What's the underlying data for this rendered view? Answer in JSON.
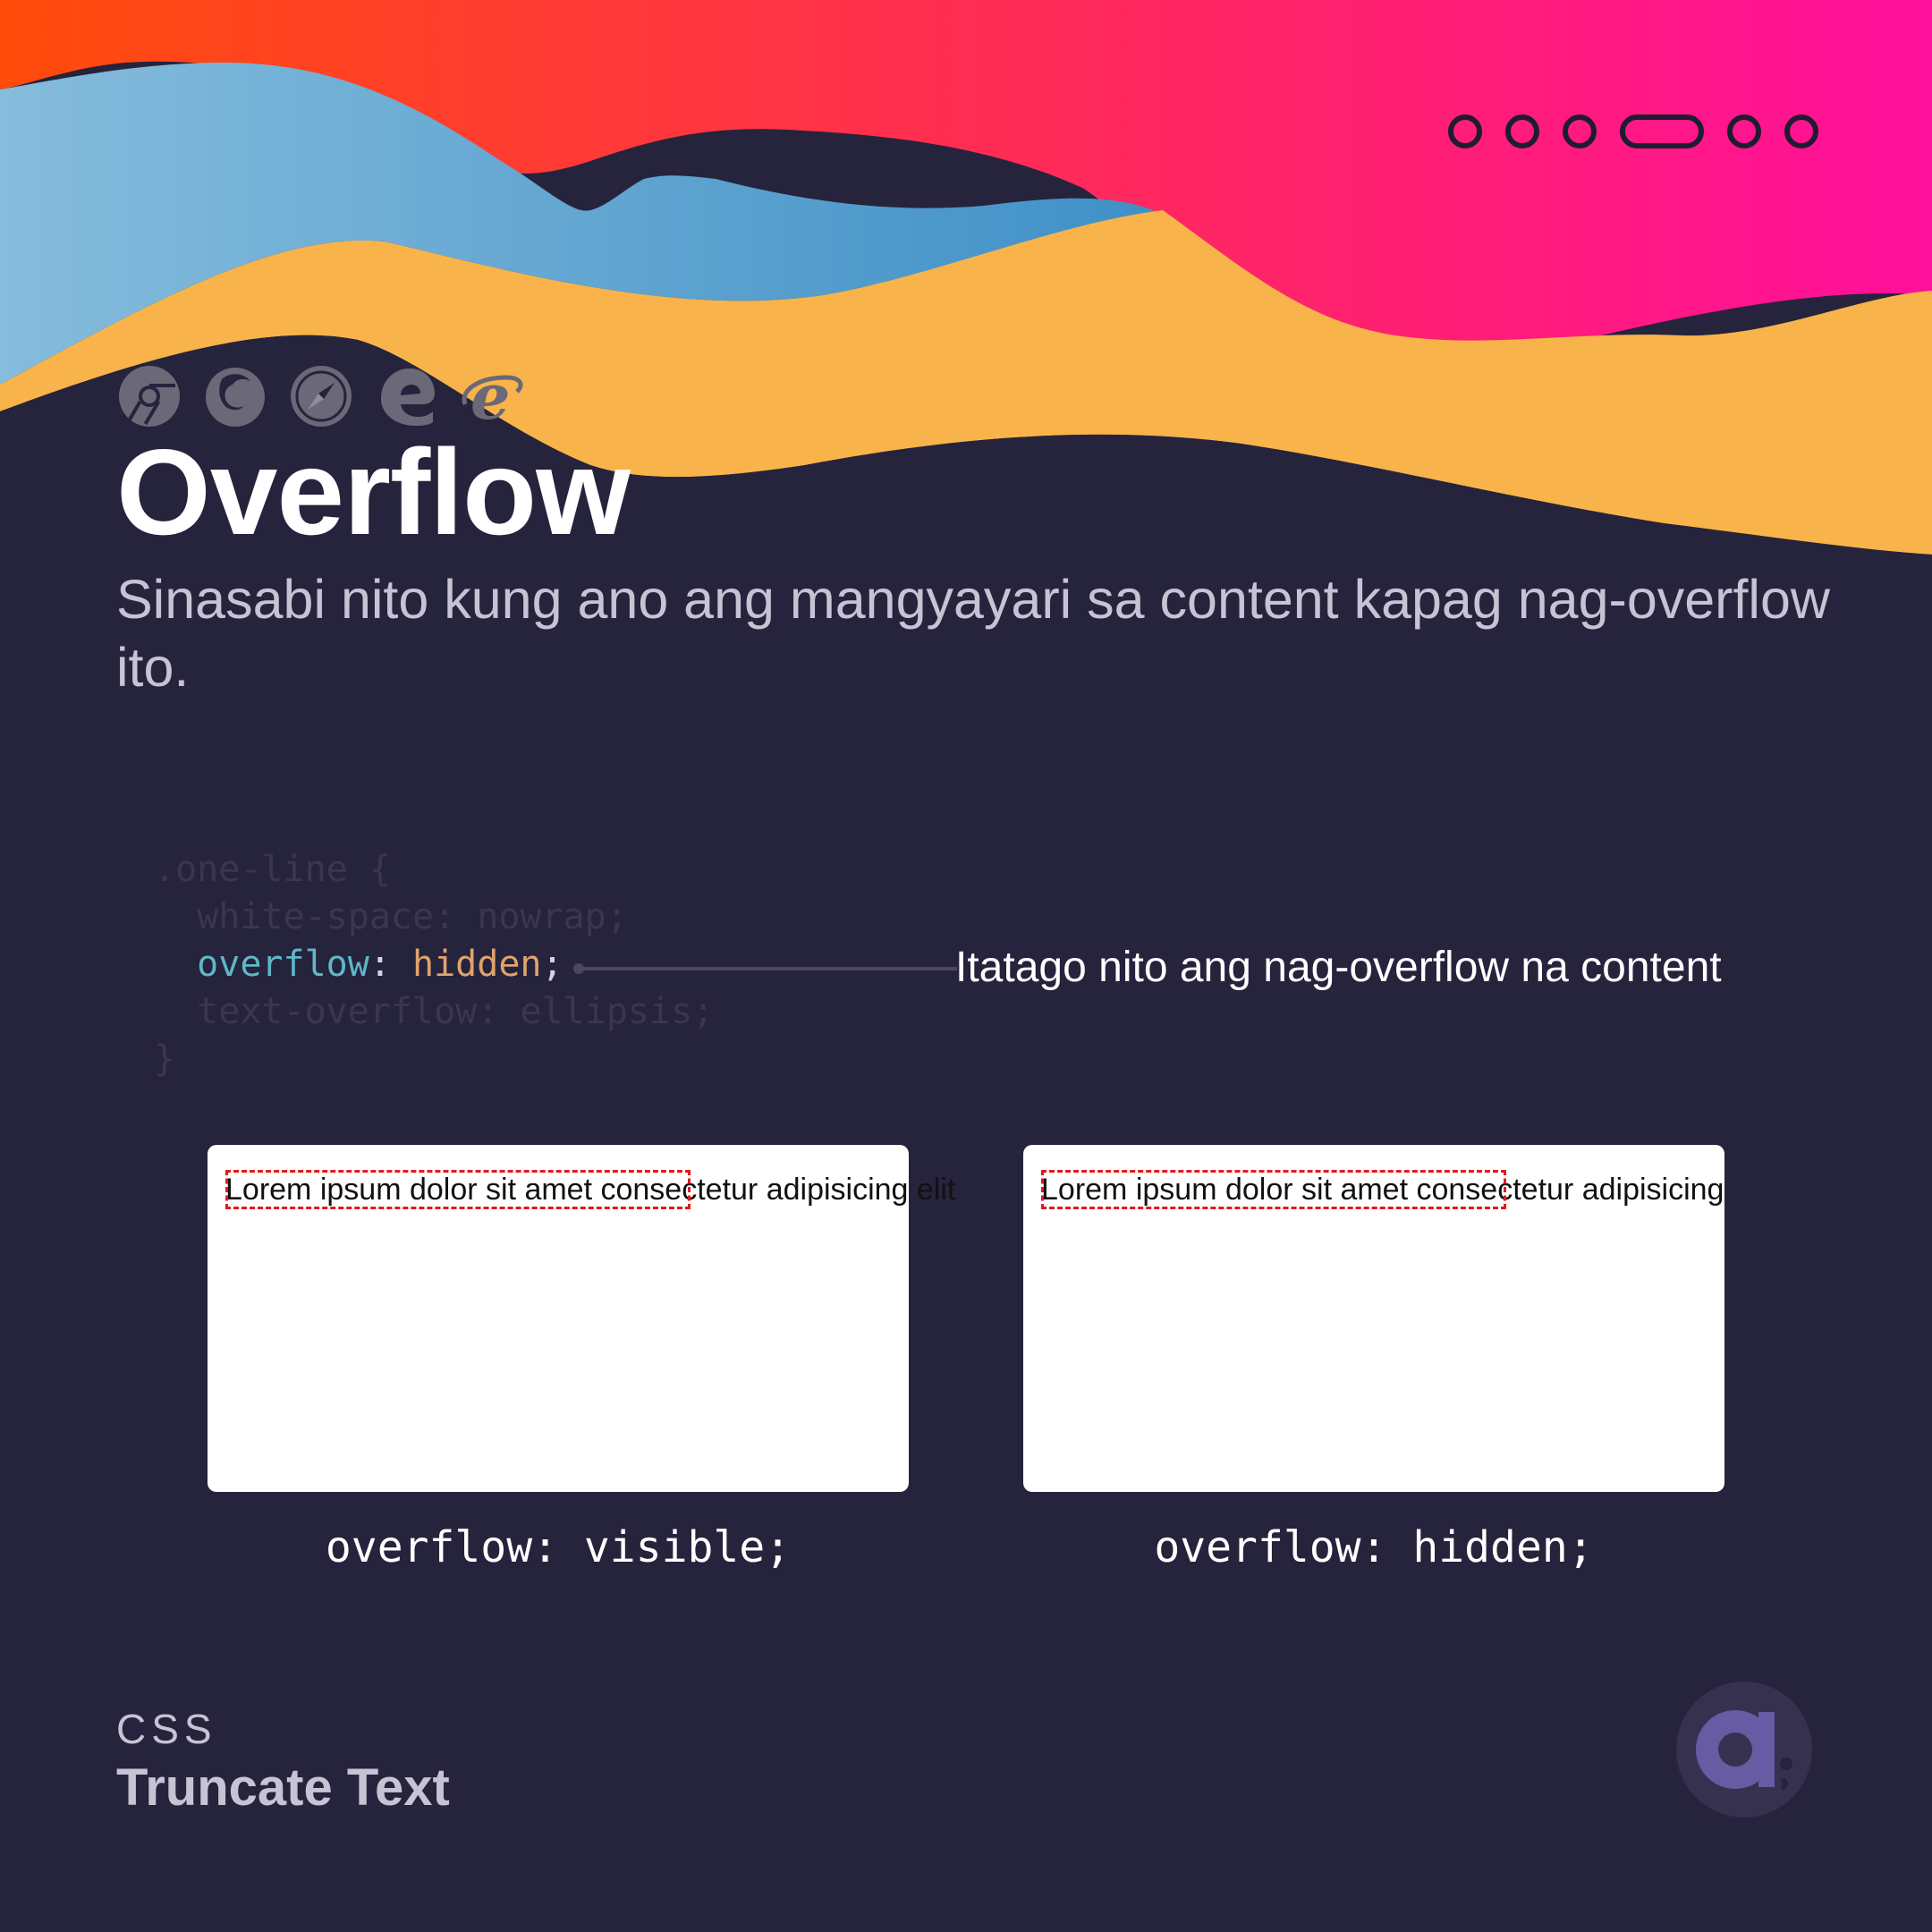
{
  "theme": {
    "background": "#26233d",
    "wave_orange_red": "#ff4c0a",
    "wave_pink": "#ff0f9b",
    "wave_blue": "#3f90c7",
    "wave_yellow": "#f8b44a",
    "code_property_color": "#5fb7c7",
    "code_value_color": "#e0a36c",
    "dash_color": "#e4181b"
  },
  "pager": {
    "total": 6,
    "active_index": 3
  },
  "browsers": [
    "chrome-icon",
    "firefox-icon",
    "safari-icon",
    "edge-icon",
    "internet-explorer-icon"
  ],
  "title": "Overflow",
  "subtitle": "Sinasabi nito kung ano ang mangyayari sa content kapag nag-overflow ito.",
  "code": {
    "line1": ".one-line {",
    "line2": "  white-space: nowrap;",
    "line3_indent": "  ",
    "line3_property": "overflow",
    "line3_colon": ": ",
    "line3_value": "hidden",
    "line3_semicolon": ";",
    "line4": "  text-overflow: ellipsis;",
    "line5": "}"
  },
  "annotation": "Itatago nito ang nag-overflow na content",
  "demos": {
    "visible": {
      "text": "Lorem ipsum dolor sit amet consectetur adipisicing elit",
      "caption": "overflow: visible;"
    },
    "hidden": {
      "text": "Lorem ipsum dolor sit amet consectetur adipisicing elit",
      "caption": "overflow: hidden;"
    }
  },
  "footer": {
    "category": "CSS",
    "topic": "Truncate Text"
  },
  "logo": {
    "name": "logo-icon",
    "circle_color": "#35314f",
    "letter_color": "#675ba3"
  }
}
